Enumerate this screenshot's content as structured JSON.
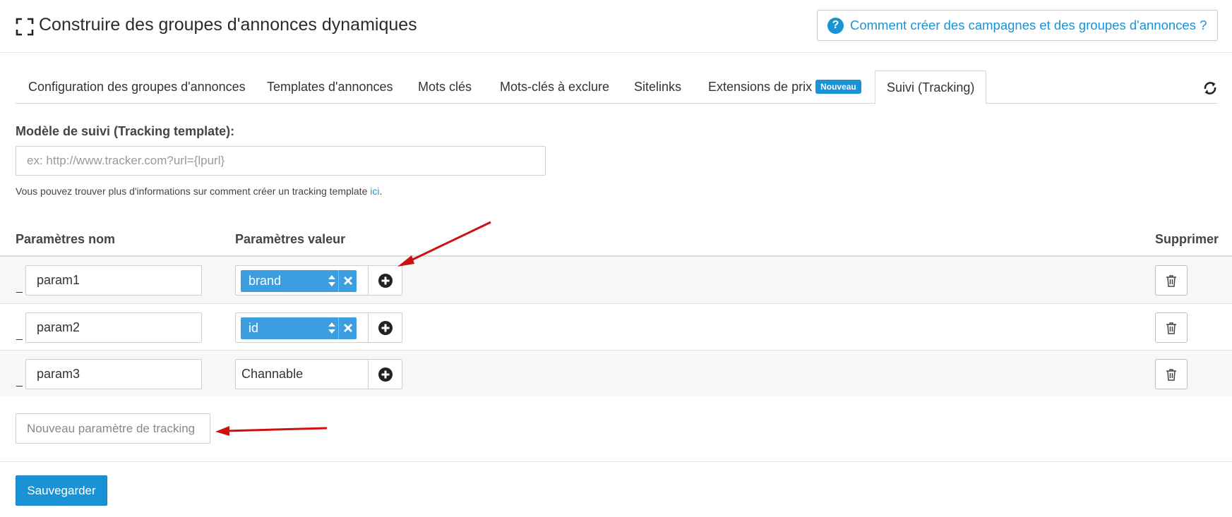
{
  "header": {
    "title": "Construire des groupes d'annonces dynamiques",
    "help_label": "Comment créer des campagnes et des groupes d'annonces ?",
    "help_icon": "question-circle-icon",
    "expand_icon": "expand-icon"
  },
  "tabs": [
    {
      "label": "Configuration des groupes d'annonces"
    },
    {
      "label": "Templates d'annonces"
    },
    {
      "label": "Mots clés"
    },
    {
      "label": "Mots-clés à exclure"
    },
    {
      "label": "Sitelinks"
    },
    {
      "label": "Extensions de prix",
      "badge": "Nouveau"
    },
    {
      "label": "Suivi (Tracking)",
      "active": true
    }
  ],
  "tracking": {
    "label": "Modèle de suivi (Tracking template):",
    "placeholder": "ex: http://www.tracker.com?url={lpurl}",
    "help_text": "Vous pouvez trouver plus d'informations sur comment créer un tracking template ",
    "help_link": "ici",
    "help_end": "."
  },
  "params": {
    "col_name": "Paramètres nom",
    "col_value": "Paramètres valeur",
    "col_delete": "Supprimer",
    "drag_symbol": "_",
    "rows": [
      {
        "name": "param1",
        "value": "brand",
        "type": "field"
      },
      {
        "name": "param2",
        "value": "id",
        "type": "field"
      },
      {
        "name": "param3",
        "value": "Channable",
        "type": "text"
      }
    ]
  },
  "new_param": {
    "placeholder": "Nouveau paramètre de tracking"
  },
  "actions": {
    "save_label": "Sauvegarder"
  },
  "colors": {
    "accent": "#1a93d6",
    "chip": "#3a9ee0",
    "annotation_arrow": "#cc1111"
  }
}
